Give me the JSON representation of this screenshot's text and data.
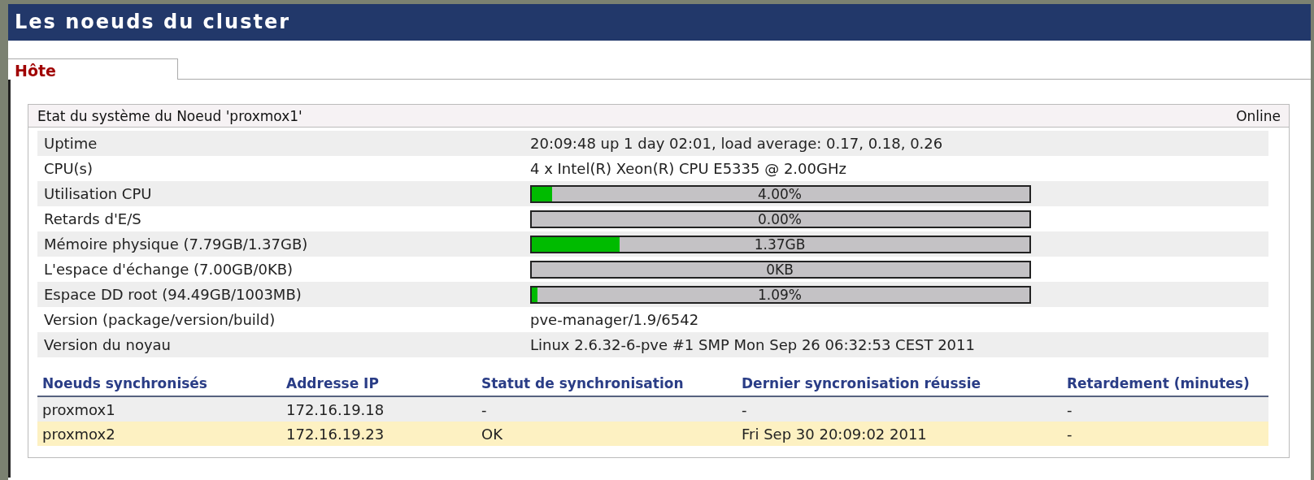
{
  "window": {
    "title": "Les noeuds du cluster"
  },
  "tabs": [
    {
      "label": "Hôte",
      "selected": true
    }
  ],
  "panel": {
    "title": "Etat du système du Noeud 'proxmox1'",
    "status": "Online"
  },
  "status_rows": [
    {
      "kind": "text",
      "label": "Uptime",
      "value": "20:09:48 up 1 day 02:01, load average: 0.17, 0.18, 0.26"
    },
    {
      "kind": "text",
      "label": "CPU(s)",
      "value": "4 x Intel(R) Xeon(R) CPU E5335 @ 2.00GHz"
    },
    {
      "kind": "meter",
      "label": "Utilisation CPU",
      "level": 0.04,
      "reading": "4.00%"
    },
    {
      "kind": "meter",
      "label": "Retards d'E/S",
      "level": 0,
      "reading": "0.00%"
    },
    {
      "kind": "meter",
      "label": "Mémoire physique (7.79GB/1.37GB)",
      "level": 0.176,
      "reading": "1.37GB"
    },
    {
      "kind": "meter",
      "label": "L'espace d'échange (7.00GB/0KB)",
      "level": 0,
      "reading": "0KB"
    },
    {
      "kind": "meter",
      "label": "Espace DD root (94.49GB/1003MB)",
      "level": 0.0109,
      "reading": "1.09%"
    },
    {
      "kind": "text",
      "label": "Version (package/version/build)",
      "value": "pve-manager/1.9/6542"
    },
    {
      "kind": "text",
      "label": "Version du noyau",
      "value": "Linux 2.6.32-6-pve #1 SMP Mon Sep 26 06:32:53 CEST 2011"
    }
  ],
  "sync_table": {
    "columns": [
      "Noeuds synchronisés",
      "Addresse IP",
      "Statut de synchronisation",
      "Dernier syncronisation réussie",
      "Retardement (minutes)"
    ],
    "rows": [
      {
        "selected": false,
        "cells": [
          "proxmox1",
          "172.16.19.18",
          "-",
          "-",
          "-"
        ]
      },
      {
        "selected": true,
        "cells": [
          "proxmox2",
          "172.16.19.23",
          "OK",
          "Fri Sep 30 20:09:02 2011",
          "-"
        ]
      }
    ]
  }
}
